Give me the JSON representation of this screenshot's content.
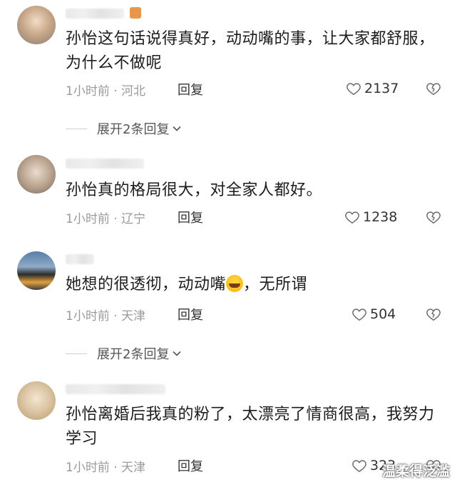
{
  "comments": [
    {
      "text": "孙怡这句话说得真好，动动嘴的事，让大家都舒服，为什么不做呢",
      "meta": "1小时前 · 河北",
      "reply_label": "回复",
      "likes": "2137",
      "expand_label": "展开2条回复"
    },
    {
      "text": "孙怡真的格局很大，对全家人都好。",
      "meta": "1小时前 · 辽宁",
      "reply_label": "回复",
      "likes": "1238"
    },
    {
      "text_before": "她想的很透彻，动动嘴",
      "text_after": "，无所谓",
      "meta": "1小时前 · 天津",
      "reply_label": "回复",
      "likes": "504",
      "expand_label": "展开2条回复"
    },
    {
      "text": "孙怡离婚后我真的粉了，太漂亮了情商很高，我努力学习",
      "meta": "1小时前 · 天津",
      "reply_label": "回复",
      "likes": "323"
    }
  ],
  "watermark": "温柔得泛滥",
  "icons": {
    "like": "heart-outline-icon",
    "dislike": "broken-heart-icon",
    "expand": "chevron-down-icon",
    "emoji": "laughing-crying-emoji-icon"
  }
}
